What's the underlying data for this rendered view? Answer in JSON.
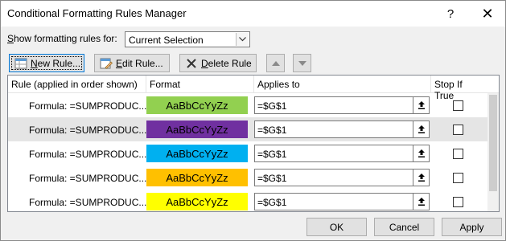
{
  "window": {
    "title": "Conditional Formatting Rules Manager",
    "help_glyph": "?",
    "close_glyph": "✕"
  },
  "show_rules": {
    "label_prefix": "",
    "label_underlined": "S",
    "label_rest": "how formatting rules for:",
    "selected": "Current Selection"
  },
  "toolbar": {
    "new_rule": {
      "u": "N",
      "rest": "ew Rule..."
    },
    "edit_rule": {
      "u": "E",
      "rest": "dit Rule..."
    },
    "delete_rule": {
      "u": "D",
      "rest": "elete Rule"
    }
  },
  "columns": {
    "rule": "Rule (applied in order shown)",
    "format": "Format",
    "applies_to": "Applies to",
    "stop_if_true": "Stop If True"
  },
  "rules": [
    {
      "rule": "Formula: =SUMPRODUC...",
      "preview": "AaBbCcYyZz",
      "color": "#92d050",
      "applies_to": "=$G$1",
      "stop": false
    },
    {
      "rule": "Formula: =SUMPRODUC...",
      "preview": "AaBbCcYyZz",
      "color": "#7030a0",
      "applies_to": "=$G$1",
      "stop": false
    },
    {
      "rule": "Formula: =SUMPRODUC...",
      "preview": "AaBbCcYyZz",
      "color": "#00b0f0",
      "applies_to": "=$G$1",
      "stop": false
    },
    {
      "rule": "Formula: =SUMPRODUC...",
      "preview": "AaBbCcYyZz",
      "color": "#ffc000",
      "applies_to": "=$G$1",
      "stop": false
    },
    {
      "rule": "Formula: =SUMPRODUC...",
      "preview": "AaBbCcYyZz",
      "color": "#ffff00",
      "applies_to": "=$G$1",
      "stop": false
    }
  ],
  "selected_row": 1,
  "footer": {
    "ok": "OK",
    "cancel": "Cancel",
    "apply": "Apply"
  }
}
